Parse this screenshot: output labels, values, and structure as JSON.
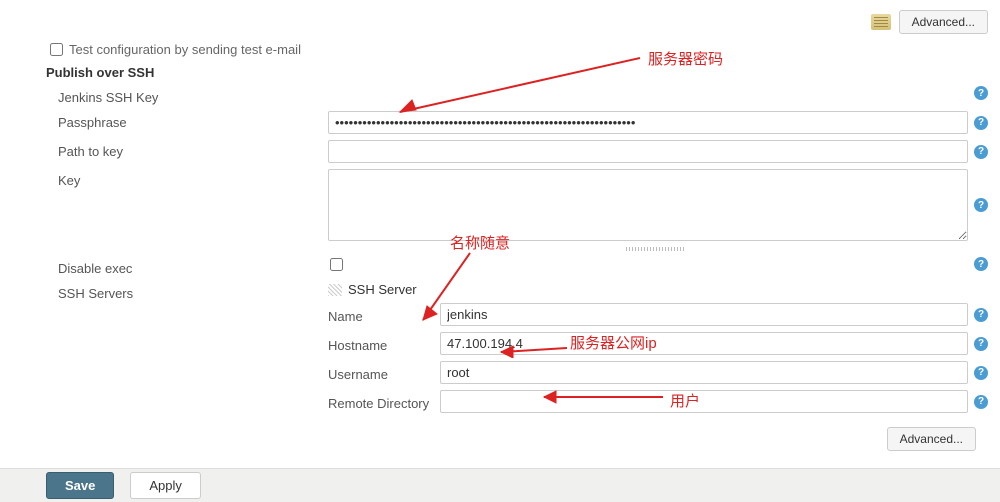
{
  "top": {
    "advanced_label": "Advanced..."
  },
  "test_config": {
    "label": "Test configuration by sending test e-mail",
    "checked": false
  },
  "section_heading": "Publish over SSH",
  "jenkins_ssh_key_label": "Jenkins SSH Key",
  "passphrase": {
    "label": "Passphrase",
    "value": "••••••••••••••••••••••••••••••••••••••••••••••••••••••••••••••••••"
  },
  "path_to_key": {
    "label": "Path to key",
    "value": ""
  },
  "key": {
    "label": "Key",
    "value": ""
  },
  "disable_exec": {
    "label": "Disable exec",
    "checked": false
  },
  "ssh_servers": {
    "label": "SSH Servers",
    "header": "SSH Server",
    "name": {
      "label": "Name",
      "value": "jenkins"
    },
    "hostname": {
      "label": "Hostname",
      "value": "47.100.194.4"
    },
    "username": {
      "label": "Username",
      "value": "root"
    },
    "remote_directory": {
      "label": "Remote Directory",
      "value": ""
    }
  },
  "bottom_advanced_label": "Advanced...",
  "buttons": {
    "save": "Save",
    "apply": "Apply"
  },
  "annotations": {
    "server_password": "服务器密码",
    "name_arbitrary": "名称随意",
    "server_public_ip": "服务器公网ip",
    "user": "用户"
  }
}
